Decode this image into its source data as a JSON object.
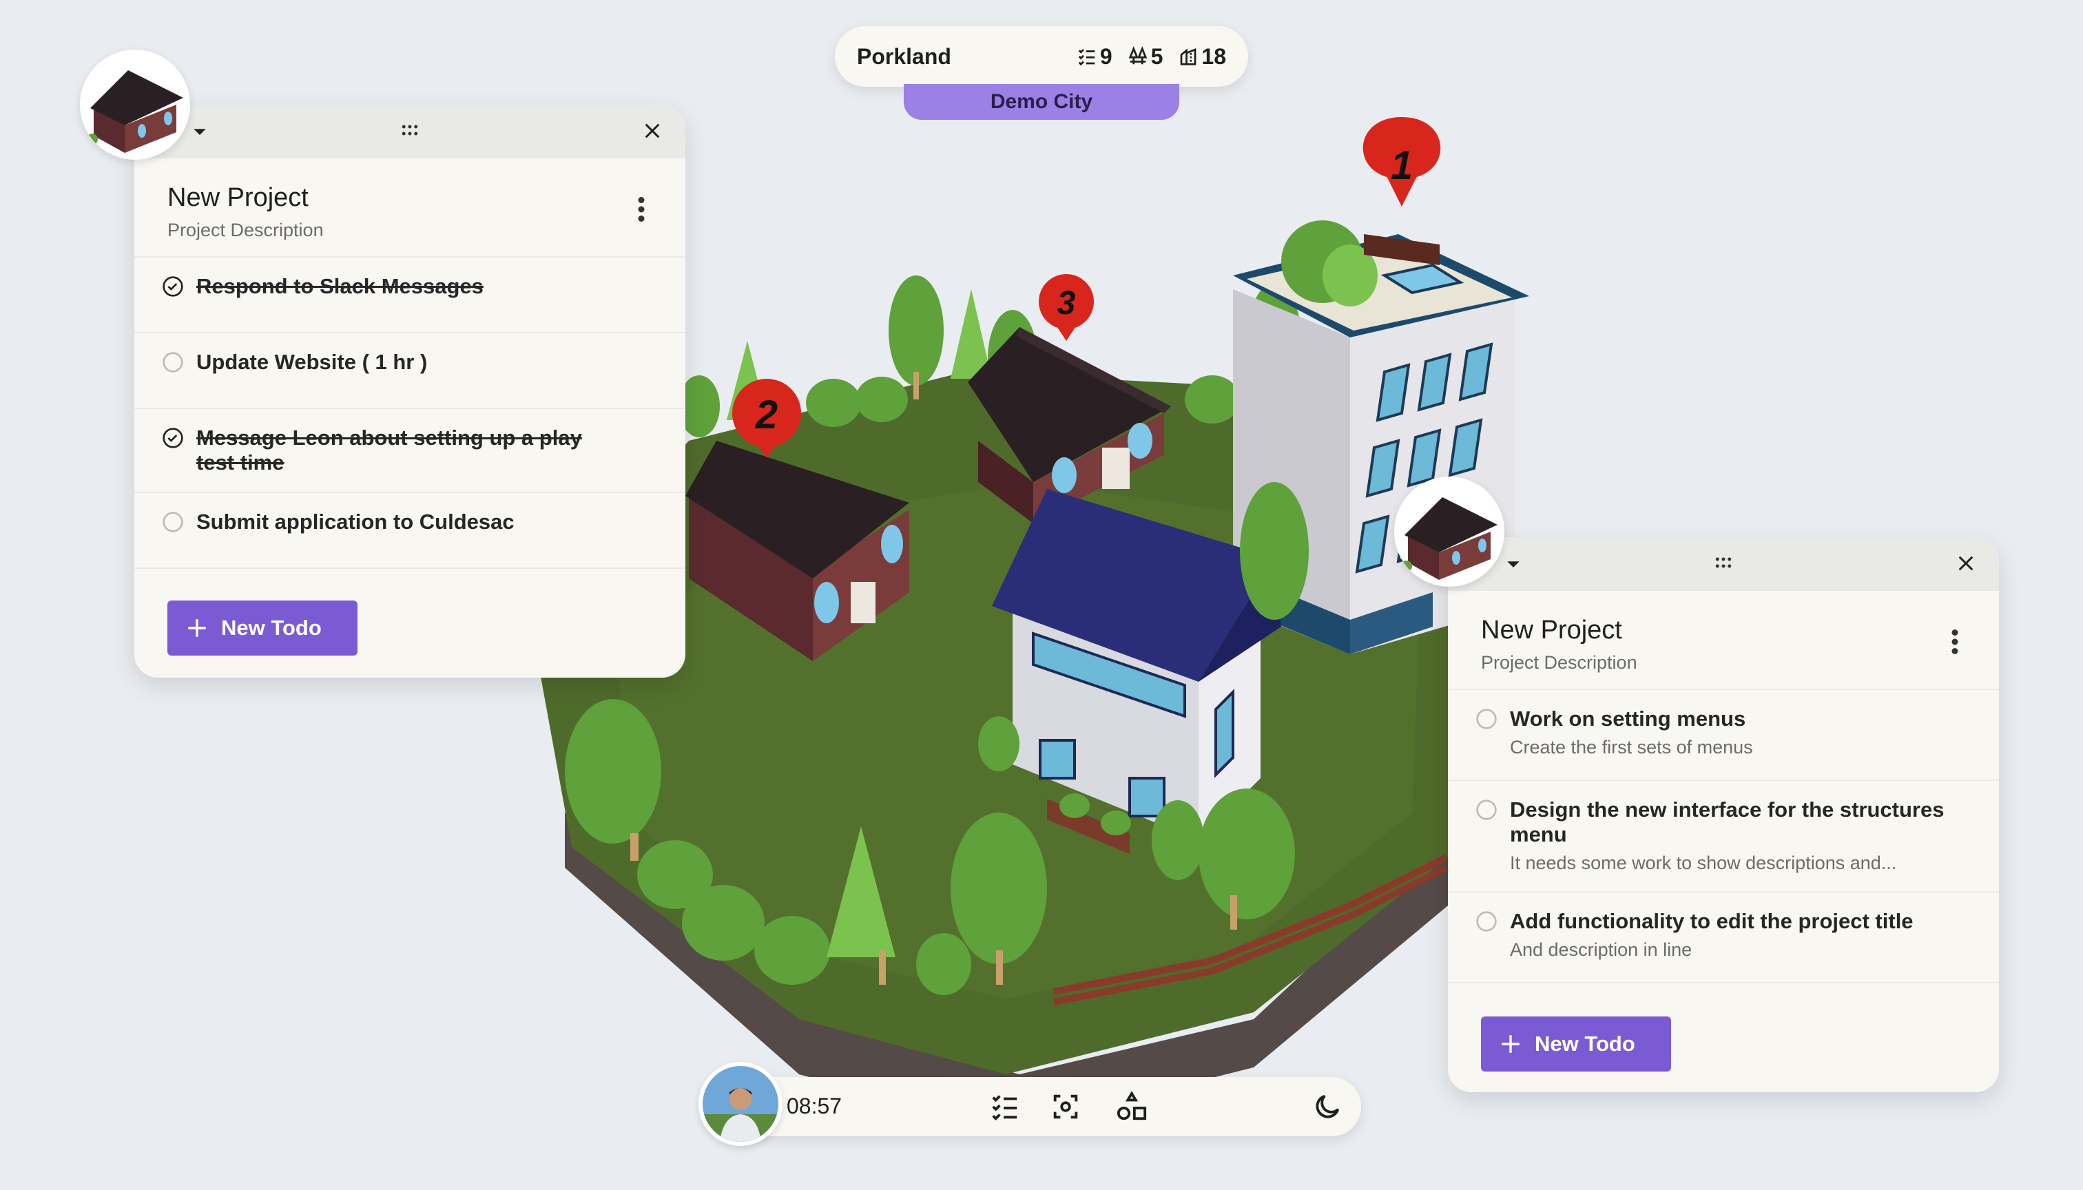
{
  "topbar": {
    "city": "Porkland",
    "stats": [
      {
        "icon": "checklist-icon",
        "value": "9"
      },
      {
        "icon": "trees-icon",
        "value": "5"
      },
      {
        "icon": "buildings-icon",
        "value": "18"
      }
    ],
    "badge": "Demo City"
  },
  "scene": {
    "markers": [
      "1",
      "2",
      "3"
    ],
    "colors": {
      "ground": "#4f6b2b",
      "tree": "#5fa13a",
      "marker": "#d8261c",
      "roof_dark": "#2a2024",
      "roof_blue": "#2a2e78",
      "wall_brick": "#7a3b3b"
    }
  },
  "left_panel": {
    "title": "New Project",
    "description": "Project Description",
    "todos": [
      {
        "title": "Respond to Slack Messages",
        "done": true
      },
      {
        "title": "Update Website ( 1 hr )",
        "done": false
      },
      {
        "title": "Message Leon about setting up a play test time",
        "done": true
      },
      {
        "title": "Submit application to Culdesac",
        "done": false
      }
    ],
    "new_todo_label": "New Todo"
  },
  "right_panel": {
    "title": "New Project",
    "description": "Project Description",
    "todos": [
      {
        "title": "Work on setting menus",
        "subtitle": "Create the first sets of menus",
        "done": false
      },
      {
        "title": "Design the new interface for the structures menu",
        "subtitle": "It needs some work to show descriptions and...",
        "done": false
      },
      {
        "title": "Add functionality to edit the project title",
        "subtitle": "And description in line",
        "done": false
      }
    ],
    "new_todo_label": "New Todo"
  },
  "bottombar": {
    "time": "08:57",
    "tools": [
      "todo-list-icon",
      "focus-icon",
      "shapes-icon"
    ],
    "theme_icon": "moon-icon"
  },
  "colors": {
    "accent": "#7b5bd3",
    "badge": "#9b80e6",
    "panel_bg": "#f8f7f2",
    "page_bg": "#e9ecf0"
  }
}
